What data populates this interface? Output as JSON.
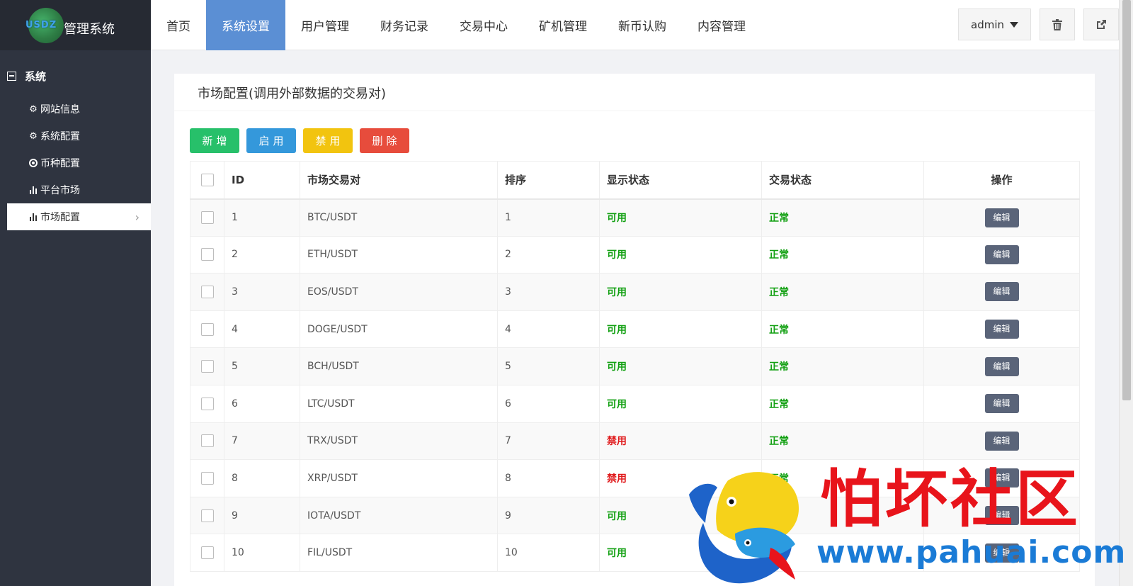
{
  "logo": {
    "badge": "USDZ",
    "text": "管理系统"
  },
  "sidebar": {
    "group_title": "系统",
    "items": [
      {
        "label": "网站信息",
        "icon": "gear-icon"
      },
      {
        "label": "系统配置",
        "icon": "gear-icon"
      },
      {
        "label": "币种配置",
        "icon": "target-icon"
      },
      {
        "label": "平台市场",
        "icon": "bar-chart-icon"
      },
      {
        "label": "市场配置",
        "icon": "bar-chart-icon",
        "active": true
      }
    ]
  },
  "nav": {
    "items": [
      "首页",
      "系统设置",
      "用户管理",
      "财务记录",
      "交易中心",
      "矿机管理",
      "新币认购",
      "内容管理"
    ],
    "active_index": 1
  },
  "user": {
    "name": "admin"
  },
  "panel": {
    "title": "市场配置(调用外部数据的交易对)",
    "buttons": {
      "add": "新增",
      "enable": "启用",
      "disable": "禁用",
      "delete": "删除"
    }
  },
  "table": {
    "headers": {
      "id": "ID",
      "pair": "市场交易对",
      "sort": "排序",
      "display": "显示状态",
      "trade": "交易状态",
      "action": "操作"
    },
    "edit_label": "编辑",
    "rows": [
      {
        "id": "1",
        "pair": "BTC/USDT",
        "sort": "1",
        "display": "可用",
        "trade": "正常"
      },
      {
        "id": "2",
        "pair": "ETH/USDT",
        "sort": "2",
        "display": "可用",
        "trade": "正常"
      },
      {
        "id": "3",
        "pair": "EOS/USDT",
        "sort": "3",
        "display": "可用",
        "trade": "正常"
      },
      {
        "id": "4",
        "pair": "DOGE/USDT",
        "sort": "4",
        "display": "可用",
        "trade": "正常"
      },
      {
        "id": "5",
        "pair": "BCH/USDT",
        "sort": "5",
        "display": "可用",
        "trade": "正常"
      },
      {
        "id": "6",
        "pair": "LTC/USDT",
        "sort": "6",
        "display": "可用",
        "trade": "正常"
      },
      {
        "id": "7",
        "pair": "TRX/USDT",
        "sort": "7",
        "display": "禁用",
        "trade": "正常"
      },
      {
        "id": "8",
        "pair": "XRP/USDT",
        "sort": "8",
        "display": "禁用",
        "trade": "正常"
      },
      {
        "id": "9",
        "pair": "IOTA/USDT",
        "sort": "9",
        "display": "可用",
        "trade": "正常"
      },
      {
        "id": "10",
        "pair": "FIL/USDT",
        "sort": "10",
        "display": "可用",
        "trade": "正常"
      }
    ]
  },
  "watermark": {
    "text": "怕坏社区",
    "url": "www.pahuai.com"
  },
  "colors": {
    "sidebar_bg": "#2f3440",
    "nav_active": "#5b8fd4",
    "status_ok": "#12a012",
    "status_off": "#e0191b",
    "edit_btn": "#5a6479"
  }
}
